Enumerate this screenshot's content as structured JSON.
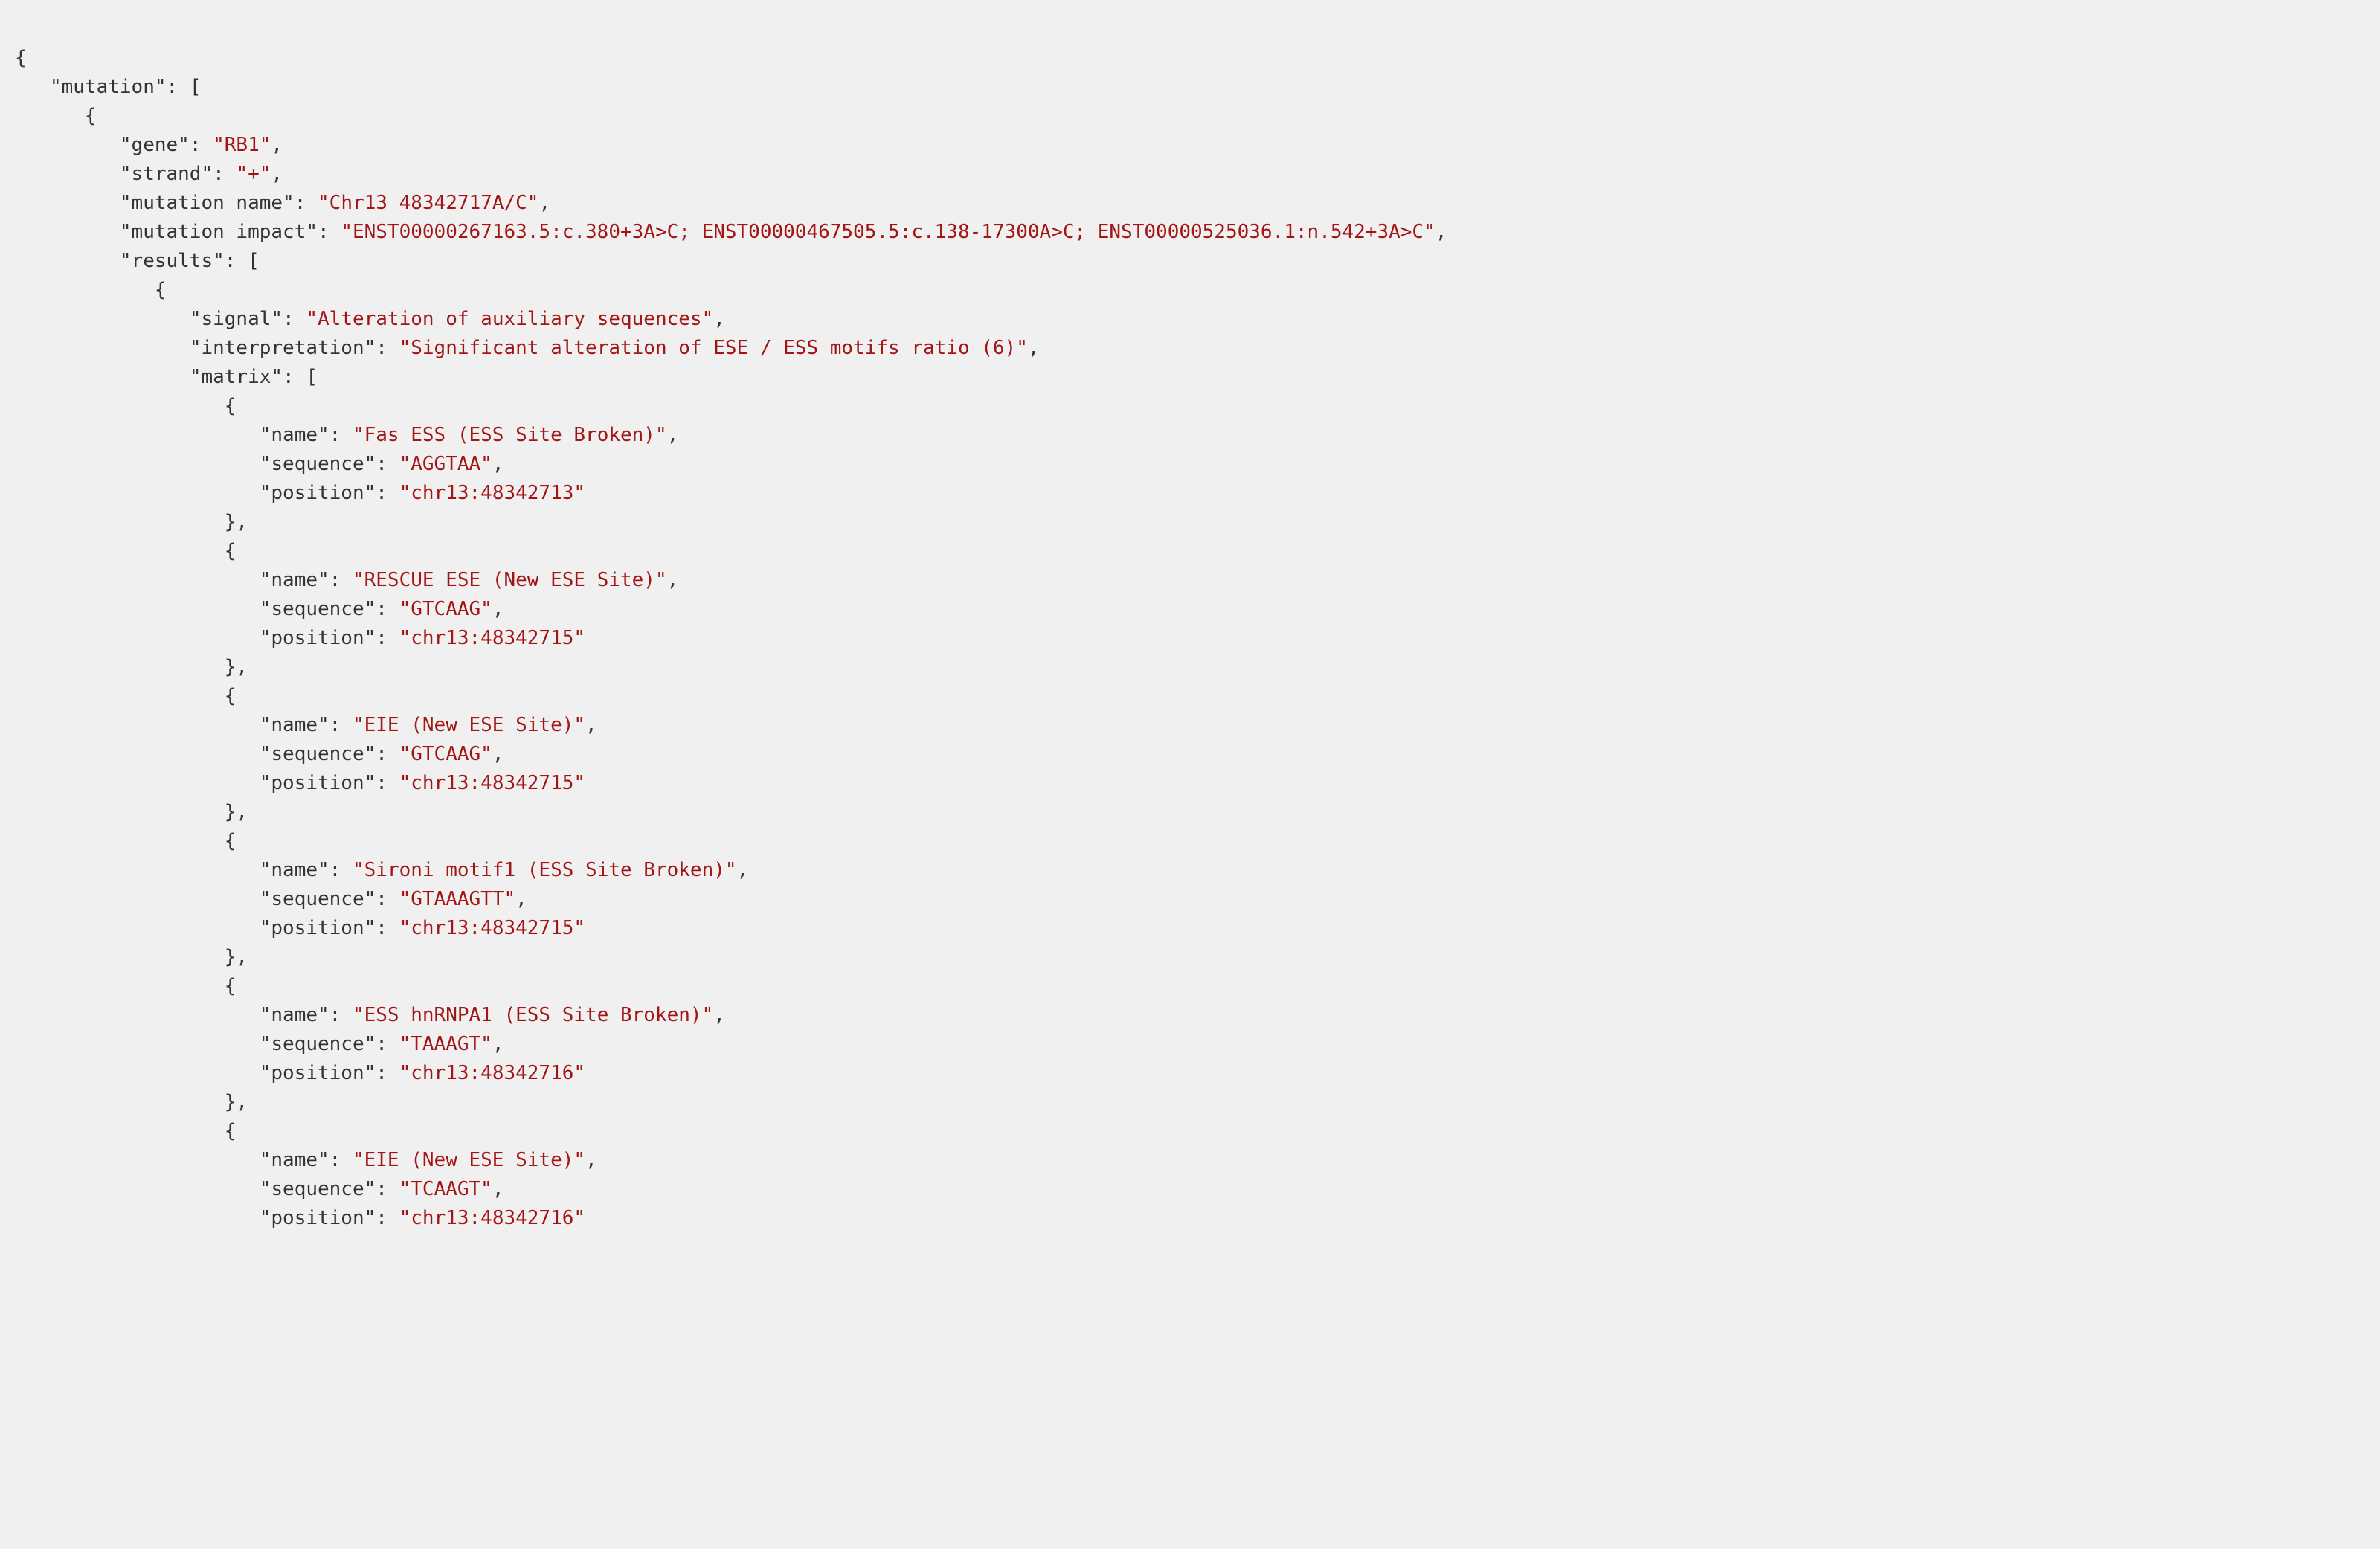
{
  "colors": {
    "punctuation": "#333333",
    "key": "#333333",
    "string": "#a31515",
    "background": "#f0f0f0"
  },
  "json": {
    "lines": [
      {
        "indent": 0,
        "tokens": [
          {
            "type": "punct",
            "text": "{"
          }
        ]
      },
      {
        "indent": 1,
        "tokens": [
          {
            "type": "key",
            "text": "\"mutation\""
          },
          {
            "type": "punct",
            "text": ": ["
          }
        ]
      },
      {
        "indent": 2,
        "tokens": [
          {
            "type": "punct",
            "text": "{"
          }
        ]
      },
      {
        "indent": 3,
        "tokens": [
          {
            "type": "key",
            "text": "\"gene\""
          },
          {
            "type": "punct",
            "text": ": "
          },
          {
            "type": "string",
            "text": "\"RB1\""
          },
          {
            "type": "punct",
            "text": ","
          }
        ]
      },
      {
        "indent": 3,
        "tokens": [
          {
            "type": "key",
            "text": "\"strand\""
          },
          {
            "type": "punct",
            "text": ": "
          },
          {
            "type": "string",
            "text": "\"+\""
          },
          {
            "type": "punct",
            "text": ","
          }
        ]
      },
      {
        "indent": 3,
        "tokens": [
          {
            "type": "key",
            "text": "\"mutation name\""
          },
          {
            "type": "punct",
            "text": ": "
          },
          {
            "type": "string",
            "text": "\"Chr13 48342717A/C\""
          },
          {
            "type": "punct",
            "text": ","
          }
        ]
      },
      {
        "indent": 3,
        "tokens": [
          {
            "type": "key",
            "text": "\"mutation impact\""
          },
          {
            "type": "punct",
            "text": ": "
          },
          {
            "type": "string",
            "text": "\"ENST00000267163.5:c.380+3A>C; ENST00000467505.5:c.138-17300A>C; ENST00000525036.1:n.542+3A>C\""
          },
          {
            "type": "punct",
            "text": ","
          }
        ]
      },
      {
        "indent": 3,
        "tokens": [
          {
            "type": "key",
            "text": "\"results\""
          },
          {
            "type": "punct",
            "text": ": ["
          }
        ]
      },
      {
        "indent": 4,
        "tokens": [
          {
            "type": "punct",
            "text": "{"
          }
        ]
      },
      {
        "indent": 5,
        "tokens": [
          {
            "type": "key",
            "text": "\"signal\""
          },
          {
            "type": "punct",
            "text": ": "
          },
          {
            "type": "string",
            "text": "\"Alteration of auxiliary sequences\""
          },
          {
            "type": "punct",
            "text": ","
          }
        ]
      },
      {
        "indent": 5,
        "tokens": [
          {
            "type": "key",
            "text": "\"interpretation\""
          },
          {
            "type": "punct",
            "text": ": "
          },
          {
            "type": "string",
            "text": "\"Significant alteration of ESE / ESS motifs ratio (6)\""
          },
          {
            "type": "punct",
            "text": ","
          }
        ]
      },
      {
        "indent": 5,
        "tokens": [
          {
            "type": "key",
            "text": "\"matrix\""
          },
          {
            "type": "punct",
            "text": ": ["
          }
        ]
      },
      {
        "indent": 6,
        "tokens": [
          {
            "type": "punct",
            "text": "{"
          }
        ]
      },
      {
        "indent": 7,
        "tokens": [
          {
            "type": "key",
            "text": "\"name\""
          },
          {
            "type": "punct",
            "text": ": "
          },
          {
            "type": "string",
            "text": "\"Fas ESS (ESS Site Broken)\""
          },
          {
            "type": "punct",
            "text": ","
          }
        ]
      },
      {
        "indent": 7,
        "tokens": [
          {
            "type": "key",
            "text": "\"sequence\""
          },
          {
            "type": "punct",
            "text": ": "
          },
          {
            "type": "string",
            "text": "\"AGGTAA\""
          },
          {
            "type": "punct",
            "text": ","
          }
        ]
      },
      {
        "indent": 7,
        "tokens": [
          {
            "type": "key",
            "text": "\"position\""
          },
          {
            "type": "punct",
            "text": ": "
          },
          {
            "type": "string",
            "text": "\"chr13:48342713\""
          }
        ]
      },
      {
        "indent": 6,
        "tokens": [
          {
            "type": "punct",
            "text": "},"
          }
        ]
      },
      {
        "indent": 6,
        "tokens": [
          {
            "type": "punct",
            "text": "{"
          }
        ]
      },
      {
        "indent": 7,
        "tokens": [
          {
            "type": "key",
            "text": "\"name\""
          },
          {
            "type": "punct",
            "text": ": "
          },
          {
            "type": "string",
            "text": "\"RESCUE ESE (New ESE Site)\""
          },
          {
            "type": "punct",
            "text": ","
          }
        ]
      },
      {
        "indent": 7,
        "tokens": [
          {
            "type": "key",
            "text": "\"sequence\""
          },
          {
            "type": "punct",
            "text": ": "
          },
          {
            "type": "string",
            "text": "\"GTCAAG\""
          },
          {
            "type": "punct",
            "text": ","
          }
        ]
      },
      {
        "indent": 7,
        "tokens": [
          {
            "type": "key",
            "text": "\"position\""
          },
          {
            "type": "punct",
            "text": ": "
          },
          {
            "type": "string",
            "text": "\"chr13:48342715\""
          }
        ]
      },
      {
        "indent": 6,
        "tokens": [
          {
            "type": "punct",
            "text": "},"
          }
        ]
      },
      {
        "indent": 6,
        "tokens": [
          {
            "type": "punct",
            "text": "{"
          }
        ]
      },
      {
        "indent": 7,
        "tokens": [
          {
            "type": "key",
            "text": "\"name\""
          },
          {
            "type": "punct",
            "text": ": "
          },
          {
            "type": "string",
            "text": "\"EIE (New ESE Site)\""
          },
          {
            "type": "punct",
            "text": ","
          }
        ]
      },
      {
        "indent": 7,
        "tokens": [
          {
            "type": "key",
            "text": "\"sequence\""
          },
          {
            "type": "punct",
            "text": ": "
          },
          {
            "type": "string",
            "text": "\"GTCAAG\""
          },
          {
            "type": "punct",
            "text": ","
          }
        ]
      },
      {
        "indent": 7,
        "tokens": [
          {
            "type": "key",
            "text": "\"position\""
          },
          {
            "type": "punct",
            "text": ": "
          },
          {
            "type": "string",
            "text": "\"chr13:48342715\""
          }
        ]
      },
      {
        "indent": 6,
        "tokens": [
          {
            "type": "punct",
            "text": "},"
          }
        ]
      },
      {
        "indent": 6,
        "tokens": [
          {
            "type": "punct",
            "text": "{"
          }
        ]
      },
      {
        "indent": 7,
        "tokens": [
          {
            "type": "key",
            "text": "\"name\""
          },
          {
            "type": "punct",
            "text": ": "
          },
          {
            "type": "string",
            "text": "\"Sironi_motif1 (ESS Site Broken)\""
          },
          {
            "type": "punct",
            "text": ","
          }
        ]
      },
      {
        "indent": 7,
        "tokens": [
          {
            "type": "key",
            "text": "\"sequence\""
          },
          {
            "type": "punct",
            "text": ": "
          },
          {
            "type": "string",
            "text": "\"GTAAAGTT\""
          },
          {
            "type": "punct",
            "text": ","
          }
        ]
      },
      {
        "indent": 7,
        "tokens": [
          {
            "type": "key",
            "text": "\"position\""
          },
          {
            "type": "punct",
            "text": ": "
          },
          {
            "type": "string",
            "text": "\"chr13:48342715\""
          }
        ]
      },
      {
        "indent": 6,
        "tokens": [
          {
            "type": "punct",
            "text": "},"
          }
        ]
      },
      {
        "indent": 6,
        "tokens": [
          {
            "type": "punct",
            "text": "{"
          }
        ]
      },
      {
        "indent": 7,
        "tokens": [
          {
            "type": "key",
            "text": "\"name\""
          },
          {
            "type": "punct",
            "text": ": "
          },
          {
            "type": "string",
            "text": "\"ESS_hnRNPA1 (ESS Site Broken)\""
          },
          {
            "type": "punct",
            "text": ","
          }
        ]
      },
      {
        "indent": 7,
        "tokens": [
          {
            "type": "key",
            "text": "\"sequence\""
          },
          {
            "type": "punct",
            "text": ": "
          },
          {
            "type": "string",
            "text": "\"TAAAGT\""
          },
          {
            "type": "punct",
            "text": ","
          }
        ]
      },
      {
        "indent": 7,
        "tokens": [
          {
            "type": "key",
            "text": "\"position\""
          },
          {
            "type": "punct",
            "text": ": "
          },
          {
            "type": "string",
            "text": "\"chr13:48342716\""
          }
        ]
      },
      {
        "indent": 6,
        "tokens": [
          {
            "type": "punct",
            "text": "},"
          }
        ]
      },
      {
        "indent": 6,
        "tokens": [
          {
            "type": "punct",
            "text": "{"
          }
        ]
      },
      {
        "indent": 7,
        "tokens": [
          {
            "type": "key",
            "text": "\"name\""
          },
          {
            "type": "punct",
            "text": ": "
          },
          {
            "type": "string",
            "text": "\"EIE (New ESE Site)\""
          },
          {
            "type": "punct",
            "text": ","
          }
        ]
      },
      {
        "indent": 7,
        "tokens": [
          {
            "type": "key",
            "text": "\"sequence\""
          },
          {
            "type": "punct",
            "text": ": "
          },
          {
            "type": "string",
            "text": "\"TCAAGT\""
          },
          {
            "type": "punct",
            "text": ","
          }
        ]
      },
      {
        "indent": 7,
        "tokens": [
          {
            "type": "key",
            "text": "\"position\""
          },
          {
            "type": "punct",
            "text": ": "
          },
          {
            "type": "string",
            "text": "\"chr13:48342716\""
          }
        ]
      }
    ],
    "indentString": "   "
  }
}
